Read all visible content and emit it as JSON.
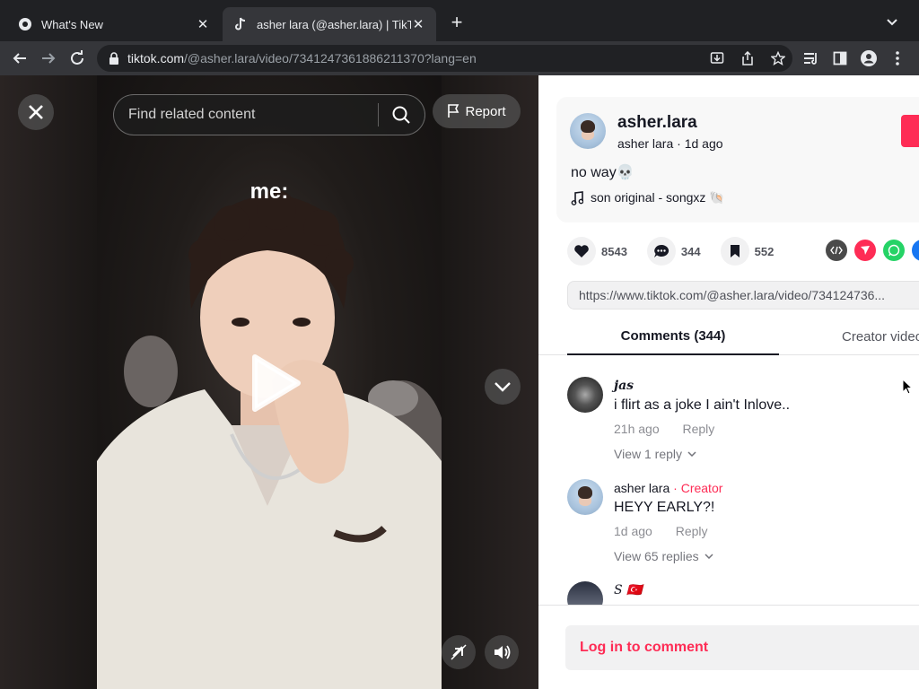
{
  "browser": {
    "tabs": [
      {
        "title": "What's New",
        "active": false
      },
      {
        "title": "asher lara (@asher.lara) | TikTok",
        "active": true
      }
    ],
    "url_host": "tiktok.com",
    "url_path": "/@asher.lara/video/7341247361886211370?lang=en"
  },
  "video": {
    "search_placeholder": "Find related content",
    "report_label": "Report",
    "caption": "me:"
  },
  "post": {
    "username": "asher.lara",
    "subline": "asher lara · 1d ago",
    "description": "no way💀",
    "music": "son original - songxz 🐚",
    "likes": "8543",
    "comments": "344",
    "saves": "552",
    "link": "https://www.tiktok.com/@asher.lara/video/734124736..."
  },
  "tabs": {
    "comments": "Comments (344)",
    "creator_videos": "Creator videos"
  },
  "comments": [
    {
      "name": "𝒋𝒂𝒔",
      "text": "i flirt as a joke I ain't Inlove..",
      "time": "21h ago",
      "reply": "Reply",
      "replies": "View 1 reply"
    },
    {
      "name": "asher lara",
      "creator_tag": "· Creator",
      "text": "HEYY EARLY?!",
      "time": "1d ago",
      "reply": "Reply",
      "replies": "View 65 replies"
    },
    {
      "name": "S 🇹🇷",
      "text": ""
    }
  ],
  "footer": {
    "login_label": "Log in to comment"
  },
  "colors": {
    "brand": "#fe2c55",
    "browser_dark": "#202124"
  }
}
